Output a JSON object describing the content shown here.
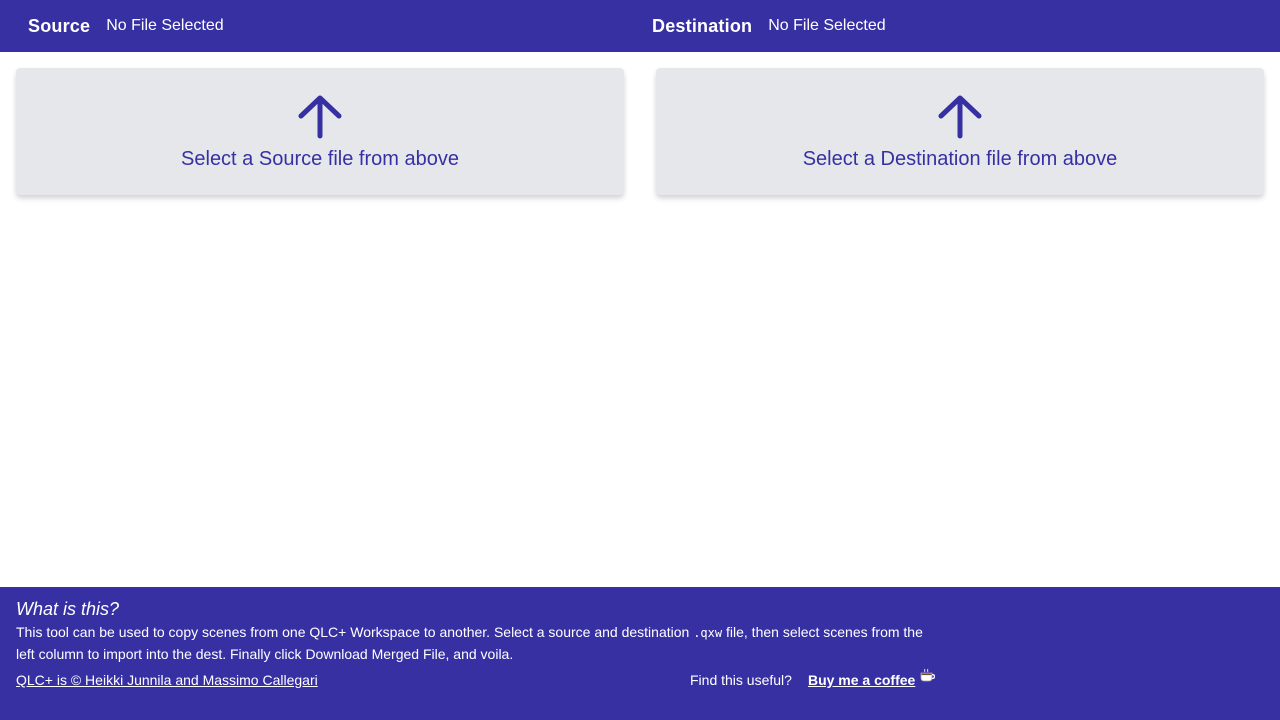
{
  "header": {
    "source": {
      "label": "Source",
      "file": "No File Selected"
    },
    "destination": {
      "label": "Destination",
      "file": "No File Selected"
    }
  },
  "dropzones": {
    "source": {
      "icon": "arrow-up-icon",
      "text": "Select a Source file from above"
    },
    "destination": {
      "icon": "arrow-up-icon",
      "text": "Select a Destination file from above"
    }
  },
  "footer": {
    "title": "What is this?",
    "desc_part1": "This tool can be used to copy scenes from one QLC+ Workspace to another. Select a source and destination ",
    "desc_ext": ".qxw",
    "desc_part2": " file, then select scenes from the left column to import into the dest. Finally click Download Merged File, and voila.",
    "copyright": "QLC+ is © Heikki Junnila and Massimo Callegari",
    "support_text": "Find this useful?",
    "coffee_link": "Buy me a coffee",
    "coffee_icon": "coffee-cup-icon"
  },
  "colors": {
    "brand": "#3730a3",
    "dropzone_bg": "#e5e7eb",
    "text_on_brand": "#ffffff"
  }
}
